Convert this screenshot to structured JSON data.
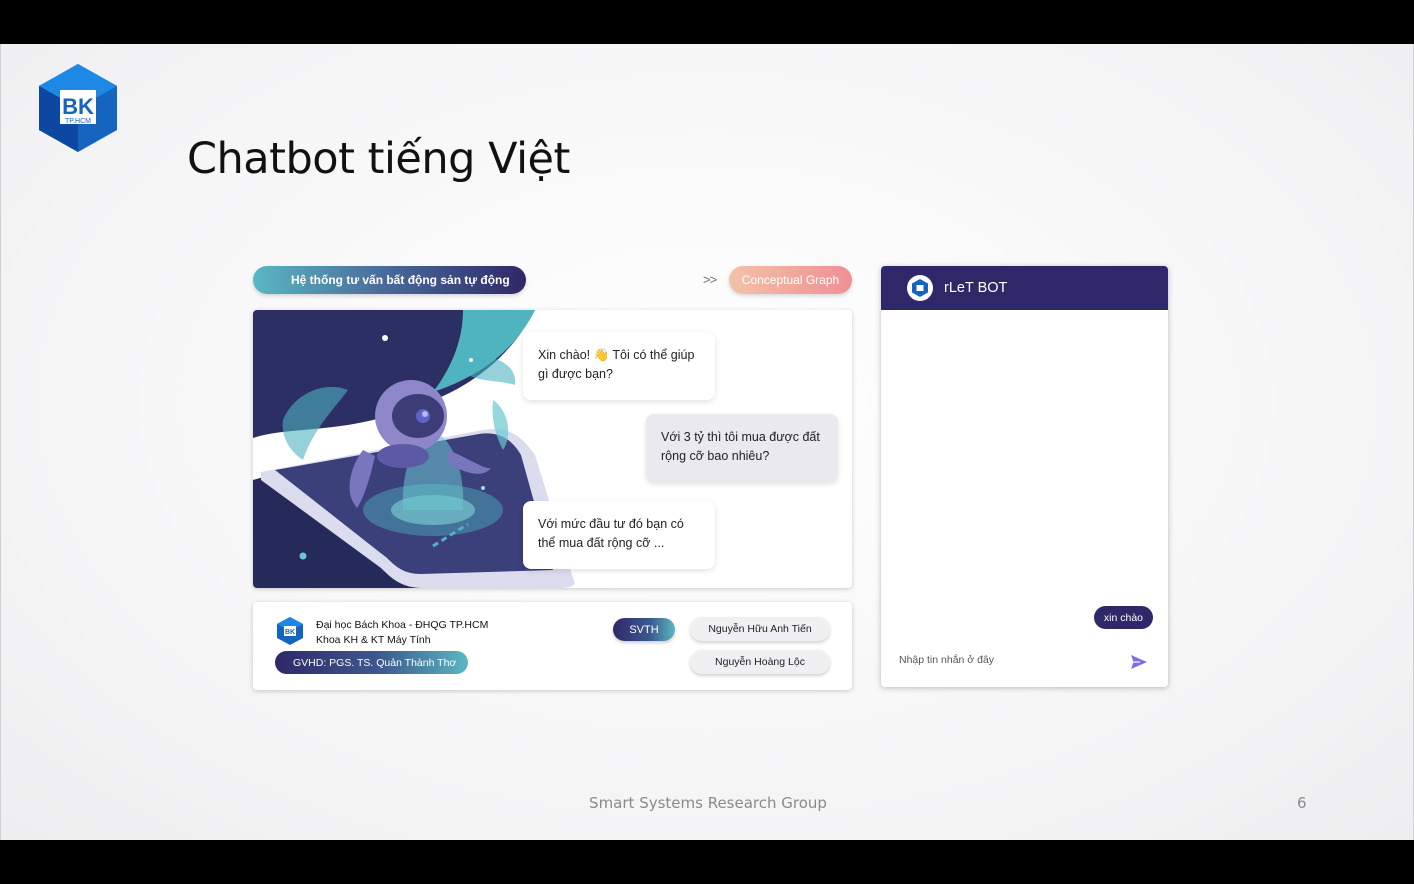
{
  "slide": {
    "logo": {
      "main": "BK",
      "sub": "TP.HCM"
    },
    "title": "Chatbot tiếng Việt",
    "footer": "Smart Systems Research Group",
    "page_number": "6"
  },
  "app": {
    "main_pill": "Hệ thống tư vấn bất động sản tự động",
    "chevron": ">>",
    "graph_pill": "Conceptual Graph",
    "bubbles": [
      "Xin chào! 👋  Tôi có thể giúp gì được bạn?",
      "Với 3 tỷ thì tôi mua được đất rộng cỡ bao nhiêu?",
      "Với mức đầu tư đó bạn có thể mua đất rộng cỡ ..."
    ],
    "university_line1": "Đại học Bách Khoa - ĐHQG TP.HCM",
    "university_line2": "Khoa KH & KT Máy Tính",
    "advisor": "GVHD:   PGS. TS. Quản Thành Thơ",
    "svth_label": "SVTH",
    "students": [
      "Nguyễn Hữu Anh Tiến",
      "Nguyễn Hoàng Lộc"
    ]
  },
  "chat": {
    "title": "rLeT BOT",
    "user_message": "xin chào",
    "input_placeholder": "Nhập tin nhắn ở đây"
  },
  "colors": {
    "primary": "#2f2868",
    "teal": "#5ab7c2",
    "peach": "#ef8f94",
    "bk_blue": "#1565c0"
  },
  "icons": {
    "send": "send-arrow-icon",
    "logo": "bk-hexagon-logo"
  }
}
